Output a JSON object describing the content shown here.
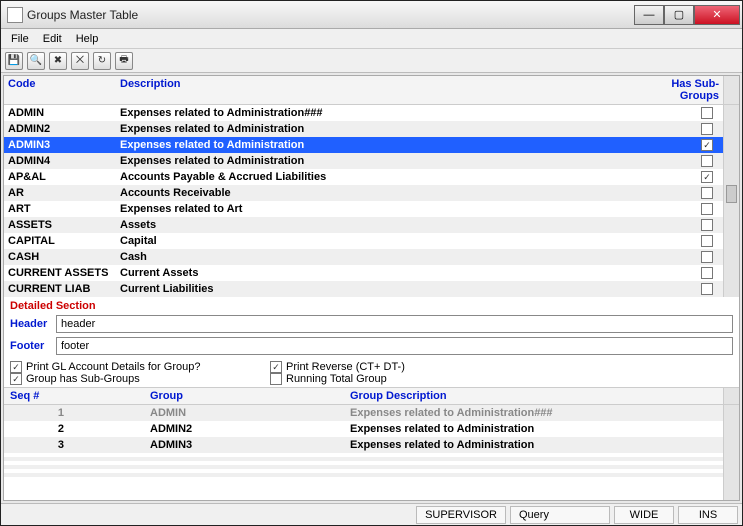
{
  "window": {
    "title": "Groups Master Table"
  },
  "menubar": [
    "File",
    "Edit",
    "Help"
  ],
  "toolbar_icons": [
    "save-icon",
    "search-icon",
    "delete-icon",
    "cancel-icon",
    "refresh-icon",
    "print-icon"
  ],
  "grid": {
    "headers": {
      "code": "Code",
      "desc": "Description",
      "has_sub": "Has Sub-Groups"
    },
    "rows": [
      {
        "code": "ADMIN",
        "desc": "Expenses related to Administration###",
        "sub": false,
        "selected": false
      },
      {
        "code": "ADMIN2",
        "desc": "Expenses related to Administration",
        "sub": false,
        "selected": false
      },
      {
        "code": "ADMIN3",
        "desc": "Expenses related to Administration",
        "sub": true,
        "selected": true
      },
      {
        "code": "ADMIN4",
        "desc": "Expenses related to Administration",
        "sub": false,
        "selected": false
      },
      {
        "code": "AP&AL",
        "desc": "Accounts Payable & Accrued Liabilities",
        "sub": true,
        "selected": false
      },
      {
        "code": "AR",
        "desc": "Accounts Receivable",
        "sub": false,
        "selected": false
      },
      {
        "code": "ART",
        "desc": "Expenses related to Art",
        "sub": false,
        "selected": false
      },
      {
        "code": "ASSETS",
        "desc": "Assets",
        "sub": false,
        "selected": false
      },
      {
        "code": "CAPITAL",
        "desc": "Capital",
        "sub": false,
        "selected": false
      },
      {
        "code": "CASH",
        "desc": "Cash",
        "sub": false,
        "selected": false
      },
      {
        "code": "CURRENT ASSETS",
        "desc": "Current Assets",
        "sub": false,
        "selected": false
      },
      {
        "code": "CURRENT LIAB",
        "desc": "Current Liabilities",
        "sub": false,
        "selected": false
      }
    ]
  },
  "detail": {
    "section_label": "Detailed Section",
    "header_label": "Header",
    "header_value": "header",
    "footer_label": "Footer",
    "footer_value": "footer"
  },
  "options": {
    "print_gl": {
      "label": "Print GL Account Details for Group?",
      "checked": true
    },
    "print_rev": {
      "label": "Print Reverse (CT+ DT-)",
      "checked": true
    },
    "has_sub": {
      "label": "Group has Sub-Groups",
      "checked": true
    },
    "run_total": {
      "label": "Running Total Group",
      "checked": false
    }
  },
  "subgrid": {
    "headers": {
      "seq": "Seq #",
      "group": "Group",
      "desc": "Group Description"
    },
    "rows": [
      {
        "seq": "1",
        "group": "ADMIN",
        "desc": "Expenses related to Administration###",
        "muted": true
      },
      {
        "seq": "2",
        "group": "ADMIN2",
        "desc": "Expenses related to Administration",
        "muted": false
      },
      {
        "seq": "3",
        "group": "ADMIN3",
        "desc": "Expenses related to Administration",
        "muted": false
      }
    ]
  },
  "statusbar": {
    "supervisor": "SUPERVISOR",
    "query": "Query",
    "wide": "WIDE",
    "ins": "INS"
  }
}
